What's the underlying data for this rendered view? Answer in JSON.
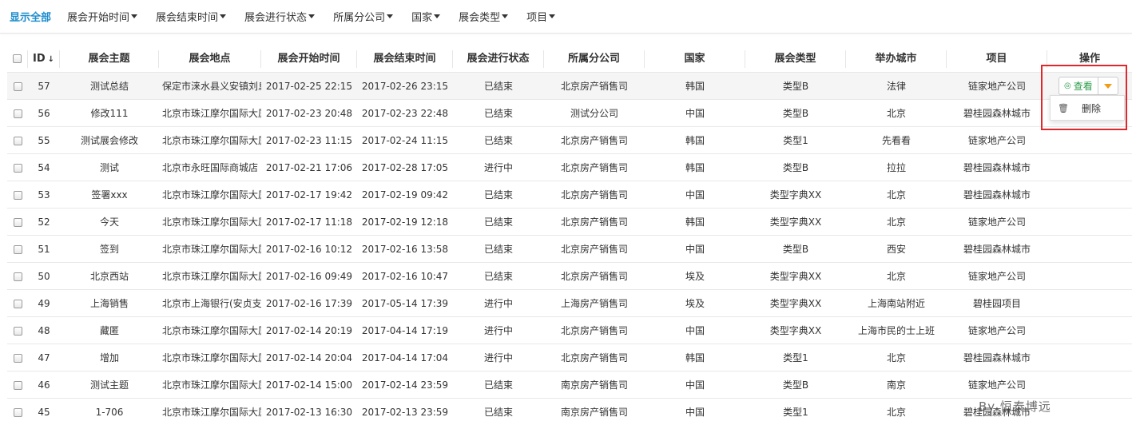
{
  "filter_bar": {
    "show_all": "显示全部",
    "filters": [
      "展会开始时间",
      "展会结束时间",
      "展会进行状态",
      "所属分公司",
      "国家",
      "展会类型",
      "项目"
    ]
  },
  "table": {
    "headers": {
      "id": "ID",
      "theme": "展会主题",
      "place": "展会地点",
      "start": "展会开始时间",
      "end": "展会结束时间",
      "state": "展会进行状态",
      "company": "所属分公司",
      "country": "国家",
      "type": "展会类型",
      "city": "举办城市",
      "project": "项目",
      "op": "操作"
    },
    "rows": [
      {
        "id": "57",
        "theme": "测试总结",
        "place": "保定市涞水县义安镇刘息",
        "start": "2017-02-25 22:15",
        "end": "2017-02-26 23:15",
        "state": "已结束",
        "company": "北京房产销售司",
        "country": "韩国",
        "type": "类型B",
        "city": "法律",
        "project": "链家地产公司"
      },
      {
        "id": "56",
        "theme": "修改111",
        "place": "北京市珠江摩尔国际大厦",
        "start": "2017-02-23 20:48",
        "end": "2017-02-23 22:48",
        "state": "已结束",
        "company": "测试分公司",
        "country": "中国",
        "type": "类型B",
        "city": "北京",
        "project": "碧桂园森林城市"
      },
      {
        "id": "55",
        "theme": "测试展会修改",
        "place": "北京市珠江摩尔国际大厦",
        "start": "2017-02-23 11:15",
        "end": "2017-02-24 11:15",
        "state": "已结束",
        "company": "北京房产销售司",
        "country": "韩国",
        "type": "类型1",
        "city": "先看看",
        "project": "链家地产公司"
      },
      {
        "id": "54",
        "theme": "测试",
        "place": "北京市永旺国际商城店",
        "start": "2017-02-21 17:06",
        "end": "2017-02-28 17:05",
        "state": "进行中",
        "company": "北京房产销售司",
        "country": "韩国",
        "type": "类型B",
        "city": "拉拉",
        "project": "碧桂园森林城市"
      },
      {
        "id": "53",
        "theme": "签署xxx",
        "place": "北京市珠江摩尔国际大厦",
        "start": "2017-02-17 19:42",
        "end": "2017-02-19 09:42",
        "state": "已结束",
        "company": "北京房产销售司",
        "country": "中国",
        "type": "类型字典XX",
        "city": "北京",
        "project": "碧桂园森林城市"
      },
      {
        "id": "52",
        "theme": "今天",
        "place": "北京市珠江摩尔国际大厦",
        "start": "2017-02-17 11:18",
        "end": "2017-02-19 12:18",
        "state": "已结束",
        "company": "北京房产销售司",
        "country": "韩国",
        "type": "类型字典XX",
        "city": "北京",
        "project": "链家地产公司"
      },
      {
        "id": "51",
        "theme": "签到",
        "place": "北京市珠江摩尔国际大厦",
        "start": "2017-02-16 10:12",
        "end": "2017-02-16 13:58",
        "state": "已结束",
        "company": "北京房产销售司",
        "country": "中国",
        "type": "类型B",
        "city": "西安",
        "project": "碧桂园森林城市"
      },
      {
        "id": "50",
        "theme": "北京西站",
        "place": "北京市珠江摩尔国际大厦",
        "start": "2017-02-16 09:49",
        "end": "2017-02-16 10:47",
        "state": "已结束",
        "company": "北京房产销售司",
        "country": "埃及",
        "type": "类型字典XX",
        "city": "北京",
        "project": "链家地产公司"
      },
      {
        "id": "49",
        "theme": "上海销售",
        "place": "北京市上海银行(安贞支行)",
        "start": "2017-02-16 17:39",
        "end": "2017-05-14 17:39",
        "state": "进行中",
        "company": "上海房产销售司",
        "country": "埃及",
        "type": "类型字典XX",
        "city": "上海南站附近",
        "project": "碧桂园项目"
      },
      {
        "id": "48",
        "theme": "藏匿",
        "place": "北京市珠江摩尔国际大厦",
        "start": "2017-02-14 20:19",
        "end": "2017-04-14 17:19",
        "state": "进行中",
        "company": "北京房产销售司",
        "country": "中国",
        "type": "类型字典XX",
        "city": "上海市民的士上班",
        "project": "链家地产公司"
      },
      {
        "id": "47",
        "theme": "增加",
        "place": "北京市珠江摩尔国际大厦",
        "start": "2017-02-14 20:04",
        "end": "2017-04-14 17:04",
        "state": "进行中",
        "company": "北京房产销售司",
        "country": "韩国",
        "type": "类型1",
        "city": "北京",
        "project": "碧桂园森林城市"
      },
      {
        "id": "46",
        "theme": "测试主题",
        "place": "北京市珠江摩尔国际大厦",
        "start": "2017-02-14 15:00",
        "end": "2017-02-14 23:59",
        "state": "已结束",
        "company": "南京房产销售司",
        "country": "中国",
        "type": "类型B",
        "city": "南京",
        "project": "链家地产公司"
      },
      {
        "id": "45",
        "theme": "1-706",
        "place": "北京市珠江摩尔国际大厦",
        "start": "2017-02-13 16:30",
        "end": "2017-02-13 23:59",
        "state": "已结束",
        "company": "南京房产销售司",
        "country": "中国",
        "type": "类型1",
        "city": "北京",
        "project": "碧桂园森林城市"
      }
    ]
  },
  "actions": {
    "view_label": "查看",
    "view_icon": "eye-icon",
    "delete_label": "删除",
    "delete_icon": "trash-icon"
  },
  "watermark": "By 恒泰博远",
  "colors": {
    "accent": "#1a8ccc",
    "view_green": "#2e9c4a",
    "toggle_orange": "#f39c12",
    "highlight_border": "#e0282c"
  }
}
